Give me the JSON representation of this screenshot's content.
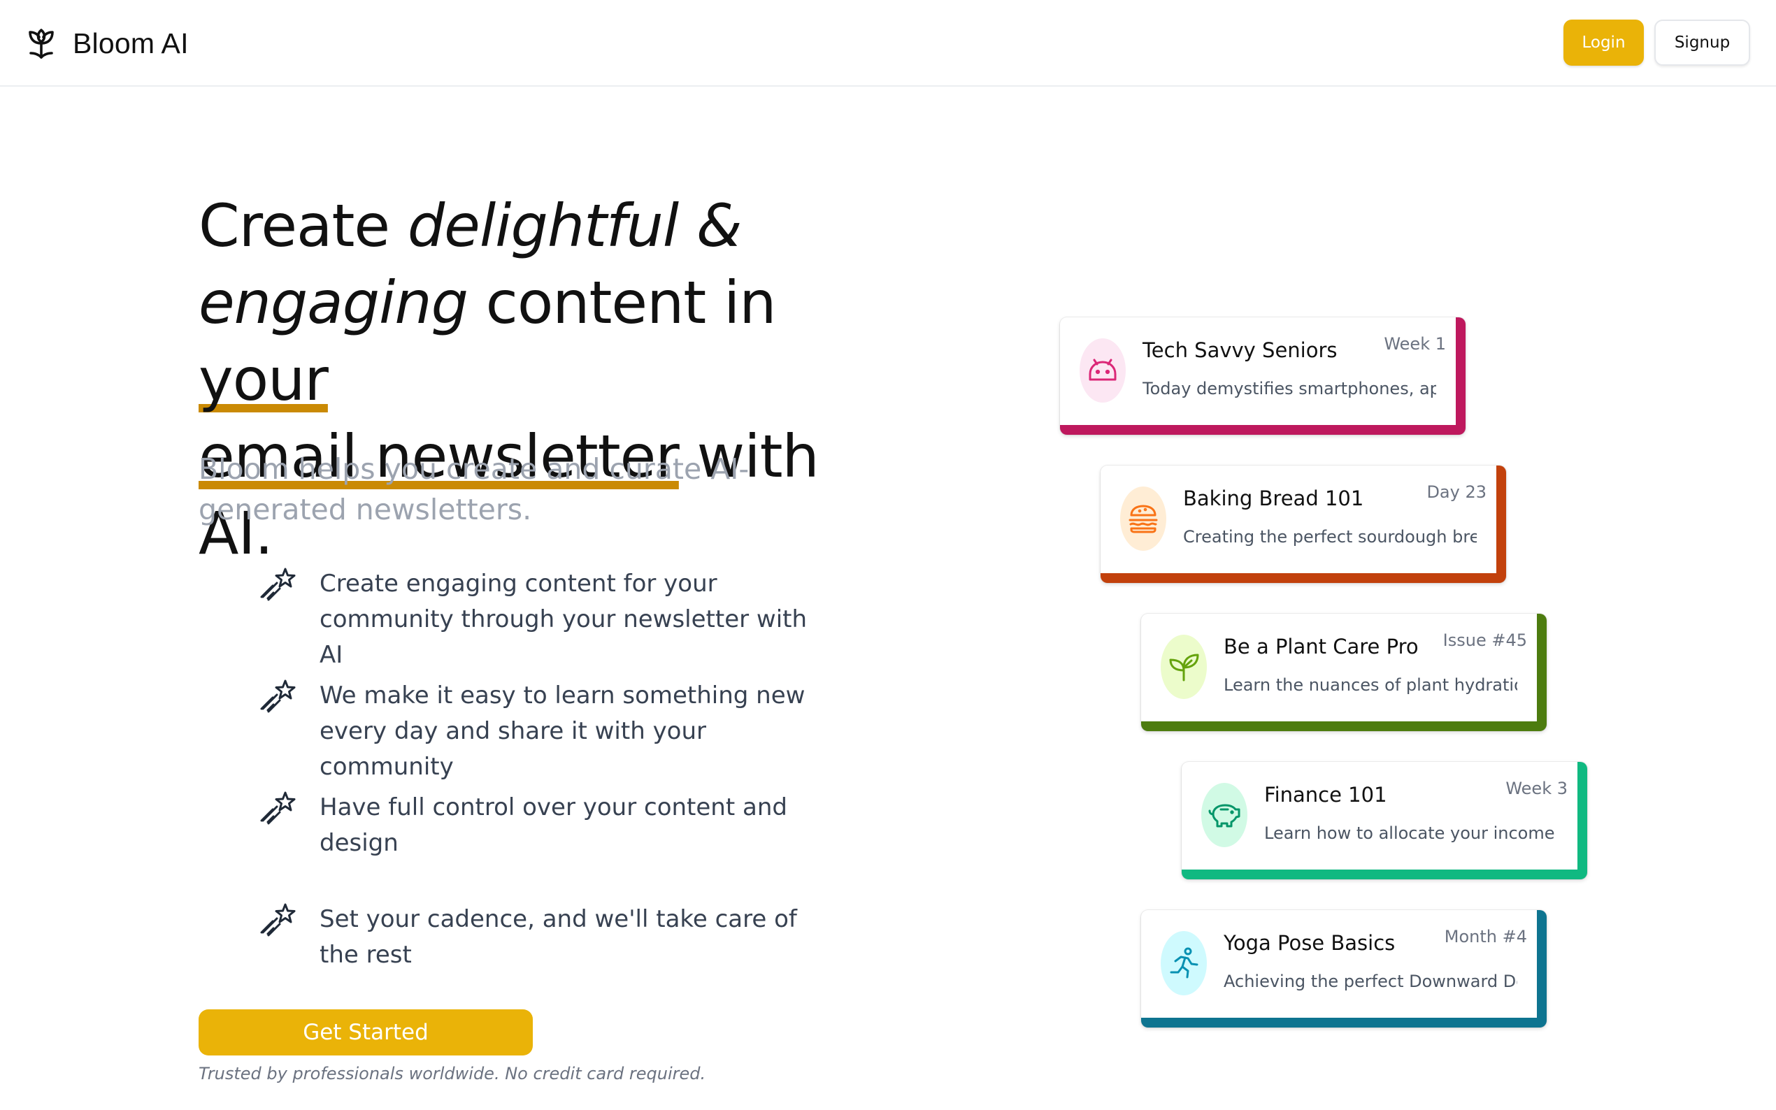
{
  "brand": {
    "name": "Bloom AI",
    "icon": "flower-icon"
  },
  "header": {
    "login_label": "Login",
    "signup_label": "Signup"
  },
  "hero": {
    "title_create": "Create",
    "title_delightful": "delightful &",
    "title_engaging": "engaging",
    "title_content_in": "content in",
    "title_your": "your",
    "title_email_newsletter": "email newsletter",
    "title_with_ai": "with AI.",
    "subtitle": "Bloom helps you create and curate AI-generated newsletters."
  },
  "features": [
    {
      "icon": "sparkle-star-icon",
      "text": "Create engaging content for your community through your newsletter with AI"
    },
    {
      "icon": "sparkle-star-icon",
      "text": "We make it easy to learn something new every day and share it with your community"
    },
    {
      "icon": "sparkle-star-icon",
      "text": "Have full control over your content and design"
    },
    {
      "icon": "sparkle-star-icon",
      "text": "Set your cadence, and we'll take care of the rest"
    }
  ],
  "cta": {
    "label": "Get Started",
    "trust_note": "Trusted by professionals worldwide. No credit card required."
  },
  "cards": [
    {
      "title": "Tech Savvy Seniors",
      "tag": "Week 1",
      "description": "Today demystifies smartphones, apps",
      "icon": "android-robot-icon",
      "accent": "#be185d",
      "icon_color": "#db2777",
      "icon_bg": "#fce7f3"
    },
    {
      "title": "Baking Bread 101",
      "tag": "Day 23",
      "description": "Creating the perfect sourdough brea",
      "icon": "burger-icon",
      "accent": "#c2410c",
      "icon_color": "#f97316",
      "icon_bg": "#ffedd5"
    },
    {
      "title": "Be a Plant Care Pro",
      "tag": "Issue #45",
      "description": "Learn the nuances of plant hydratio",
      "icon": "plant-sprout-icon",
      "accent": "#4d7c0f",
      "icon_color": "#65a30d",
      "icon_bg": "#ecfccb"
    },
    {
      "title": "Finance 101",
      "tag": "Week 3",
      "description": "Learn how to allocate your income wis",
      "icon": "piggy-bank-icon",
      "accent": "#10b981",
      "icon_color": "#059669",
      "icon_bg": "#d1fae5"
    },
    {
      "title": "Yoga Pose Basics",
      "tag": "Month #4",
      "description": "Achieving the perfect Downward Dog,",
      "icon": "running-person-icon",
      "accent": "#0e7490",
      "icon_color": "#0891b2",
      "icon_bg": "#cffafe"
    }
  ],
  "colors": {
    "accent_yellow": "#eab308",
    "underline_gold": "#ca8a04",
    "muted_text": "#9ca3af",
    "body_text": "#374151"
  }
}
